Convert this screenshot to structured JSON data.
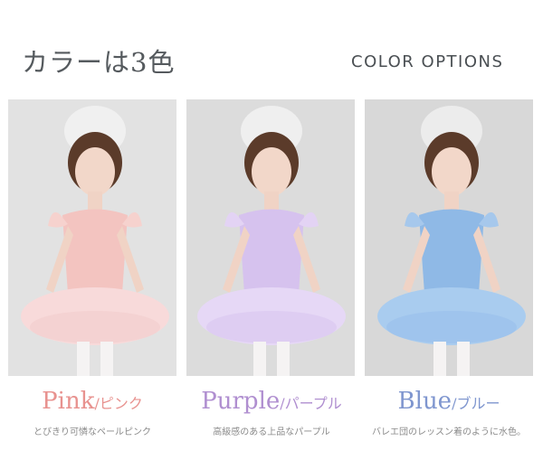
{
  "header": {
    "title_jp": "カラーは3色",
    "title_en": "COLOR OPTIONS"
  },
  "options": [
    {
      "name": "Pink",
      "kana": "/ピンク",
      "desc": "とびきり可憐なペールピンク",
      "accent": "#e8928f",
      "dress": "#f3c4c0",
      "tutu": "#f8dada",
      "bg": "#dcdcdc"
    },
    {
      "name": "Purple",
      "kana": "/パープル",
      "desc": "高級感のある上品なパープル",
      "accent": "#b08fd0",
      "dress": "#d6c2ee",
      "tutu": "#e6d8f6",
      "bg": "#dddddd"
    },
    {
      "name": "Blue",
      "kana": "/ブルー",
      "desc": "バレエ団のレッスン着のように水色。",
      "accent": "#7f96cf",
      "dress": "#8fb9e6",
      "tutu": "#a9ccef",
      "bg": "#d6d6d6"
    }
  ]
}
